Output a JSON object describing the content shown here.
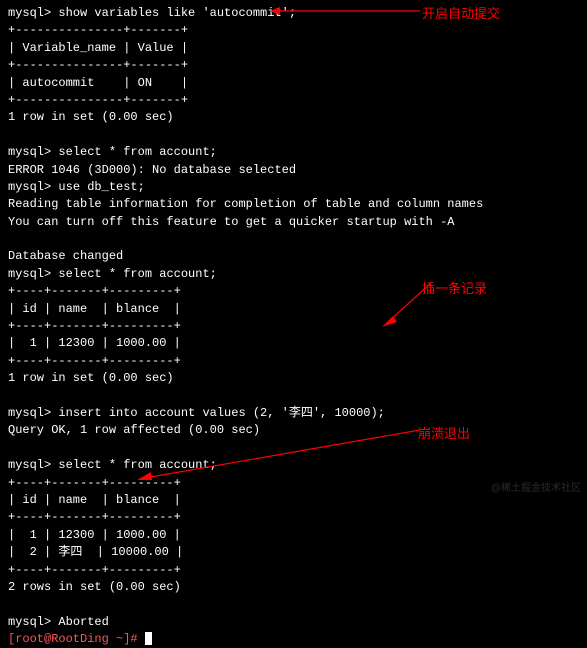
{
  "prompts": {
    "mysql": "mysql>",
    "shell": "[root@RootDing ~]#"
  },
  "commands": {
    "c1": "show variables like 'autocommit';",
    "c2": "select * from account;",
    "c3": "use db_test;",
    "c4": "insert into account values (2, '李四', 10000);",
    "c5": "select * from account;",
    "c6": "select * from account;"
  },
  "table1": {
    "border_top": "+---------------+-------+",
    "header": "| Variable_name | Value |",
    "border_mid": "+---------------+-------+",
    "row": "| autocommit    | ON    |",
    "border_bot": "+---------------+-------+",
    "summary": "1 row in set (0.00 sec)"
  },
  "errors": {
    "e1": "ERROR 1046 (3D000): No database selected"
  },
  "messages": {
    "m1": "Reading table information for completion of table and column names",
    "m2": "You can turn off this feature to get a quicker startup with -A",
    "m3": "Database changed",
    "m4": "Query OK, 1 row affected (0.00 sec)",
    "m5": "Aborted"
  },
  "table2": {
    "border_top": "+----+-------+---------+",
    "header": "| id | name  | blance  |",
    "border_mid": "+----+-------+---------+",
    "row1": "|  1 | 12300 | 1000.00 |",
    "border_bot": "+----+-------+---------+",
    "summary": "1 row in set (0.00 sec)"
  },
  "table3": {
    "border_top": "+----+-------+---------+",
    "header": "| id | name  | blance  |",
    "border_mid": "+----+-------+---------+",
    "row1": "|  1 | 12300 | 1000.00 |",
    "row2": "|  2 | 李四  | 10000.00 |",
    "border_bot": "+----+-------+---------+",
    "summary": "2 rows in set (0.00 sec)"
  },
  "annotations": {
    "a1": "开启自动提交",
    "a2": "插一条记录",
    "a3": "崩溃退出"
  },
  "watermark": "@稀土掘金技术社区"
}
